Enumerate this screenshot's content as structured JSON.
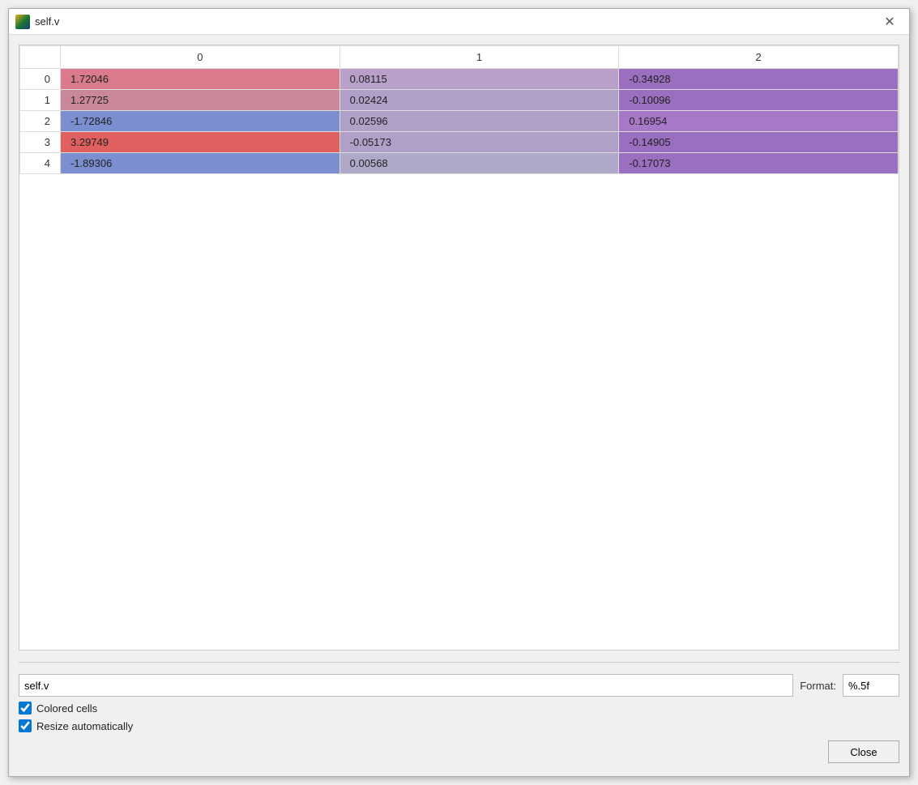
{
  "window": {
    "title": "self.v",
    "icon": "pc-icon"
  },
  "table": {
    "columns": [
      "0",
      "1",
      "2"
    ],
    "rows": [
      {
        "index": "0",
        "cells": [
          {
            "value": "1.72046",
            "bg": "#d97b8a",
            "color": "#222"
          },
          {
            "value": "0.08115",
            "bg": "#b8a0c8",
            "color": "#222"
          },
          {
            "value": "-0.34928",
            "bg": "#9b6fbf",
            "color": "#222"
          }
        ]
      },
      {
        "index": "1",
        "cells": [
          {
            "value": "1.27725",
            "bg": "#c98898",
            "color": "#222"
          },
          {
            "value": "0.02424",
            "bg": "#b0a0c8",
            "color": "#222"
          },
          {
            "value": "-0.10096",
            "bg": "#9b6fbf",
            "color": "#222"
          }
        ]
      },
      {
        "index": "2",
        "cells": [
          {
            "value": "-1.72846",
            "bg": "#7b8fd0",
            "color": "#222"
          },
          {
            "value": "0.02596",
            "bg": "#b0a0c8",
            "color": "#222"
          },
          {
            "value": "0.16954",
            "bg": "#a878c8",
            "color": "#222"
          }
        ]
      },
      {
        "index": "3",
        "cells": [
          {
            "value": "3.29749",
            "bg": "#e06060",
            "color": "#222"
          },
          {
            "value": "-0.05173",
            "bg": "#b0a0c8",
            "color": "#222"
          },
          {
            "value": "-0.14905",
            "bg": "#9b6fbf",
            "color": "#222"
          }
        ]
      },
      {
        "index": "4",
        "cells": [
          {
            "value": "-1.89306",
            "bg": "#7b8fd0",
            "color": "#222"
          },
          {
            "value": "0.00568",
            "bg": "#b0a8c8",
            "color": "#222"
          },
          {
            "value": "-0.17073",
            "bg": "#9b6fbf",
            "color": "#222"
          }
        ]
      }
    ]
  },
  "bottom": {
    "name_value": "self.v",
    "name_placeholder": "",
    "format_label": "Format:",
    "format_value": "%.5f",
    "colored_cells_label": "Colored cells",
    "colored_cells_checked": true,
    "resize_auto_label": "Resize automatically",
    "resize_auto_checked": true,
    "close_label": "Close"
  }
}
